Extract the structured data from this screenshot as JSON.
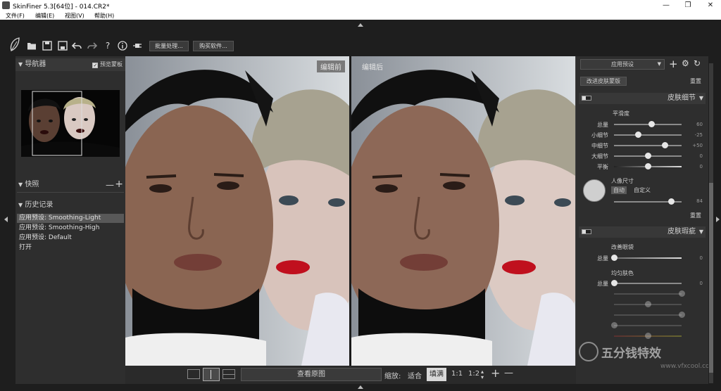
{
  "window": {
    "title": "SkinFiner 5.3[64位] - 014.CR2*",
    "minimize": "—",
    "maximize": "❐",
    "close": "✕"
  },
  "menu": [
    "文件(F)",
    "编辑(E)",
    "视图(V)",
    "帮助(H)"
  ],
  "toolbar": {
    "batch_label": "批量处理...",
    "buy_label": "购买软件..."
  },
  "navigator": {
    "title": "导航器",
    "preview_mask_label": "预览蒙板",
    "preview_mask_checked": true
  },
  "snapshot": {
    "title": "快照",
    "remove": "—",
    "add": "+"
  },
  "history": {
    "title": "历史记录",
    "items": [
      "应用预设: Smoothing-Light",
      "应用预设: Smoothing-High",
      "应用预设: Default",
      "打开"
    ],
    "selected_index": 0
  },
  "canvas": {
    "before_label": "编辑前",
    "after_label": "编辑后"
  },
  "bottom": {
    "view_original": "查看原图",
    "zoom_label": "缩放:",
    "zoom_fit": "适合",
    "zoom_fill": "填满",
    "zoom_1_1": "1:1",
    "zoom_1_2": "1:2",
    "plus": "+",
    "minus": "—"
  },
  "right": {
    "preset_select": "应用预设",
    "improve_mask": "改进皮肤蒙版",
    "reset_top": "重置",
    "skin_detail": {
      "title": "皮肤细节",
      "group_label": "平滑度",
      "sliders": [
        {
          "label": "总量",
          "value": 60
        },
        {
          "label": "小细节",
          "value": -25
        },
        {
          "label": "中细节",
          "value": "+50"
        },
        {
          "label": "大细节",
          "value": 0
        },
        {
          "label": "平衡",
          "value": 0
        }
      ],
      "portrait_size_label": "人像尺寸",
      "auto_label": "自动",
      "custom_label": "自定义",
      "portrait_value": 84,
      "reset": "重置"
    },
    "skin_blemish": {
      "title": "皮肤瑕疵",
      "eye_bags_label": "改善眼袋",
      "eye_amount_label": "总量",
      "eye_amount_value": 0,
      "even_tone_label": "均匀肤色",
      "tone_sliders": [
        {
          "label": "总量",
          "value": 0
        },
        {
          "label": "",
          "value": ""
        },
        {
          "label": "",
          "value": ""
        },
        {
          "label": "",
          "value": ""
        },
        {
          "label": "",
          "value": ""
        },
        {
          "label": "",
          "value": ""
        }
      ]
    }
  },
  "watermark": {
    "brand": "五分钱特效",
    "url": "www.vfxcool.com"
  }
}
